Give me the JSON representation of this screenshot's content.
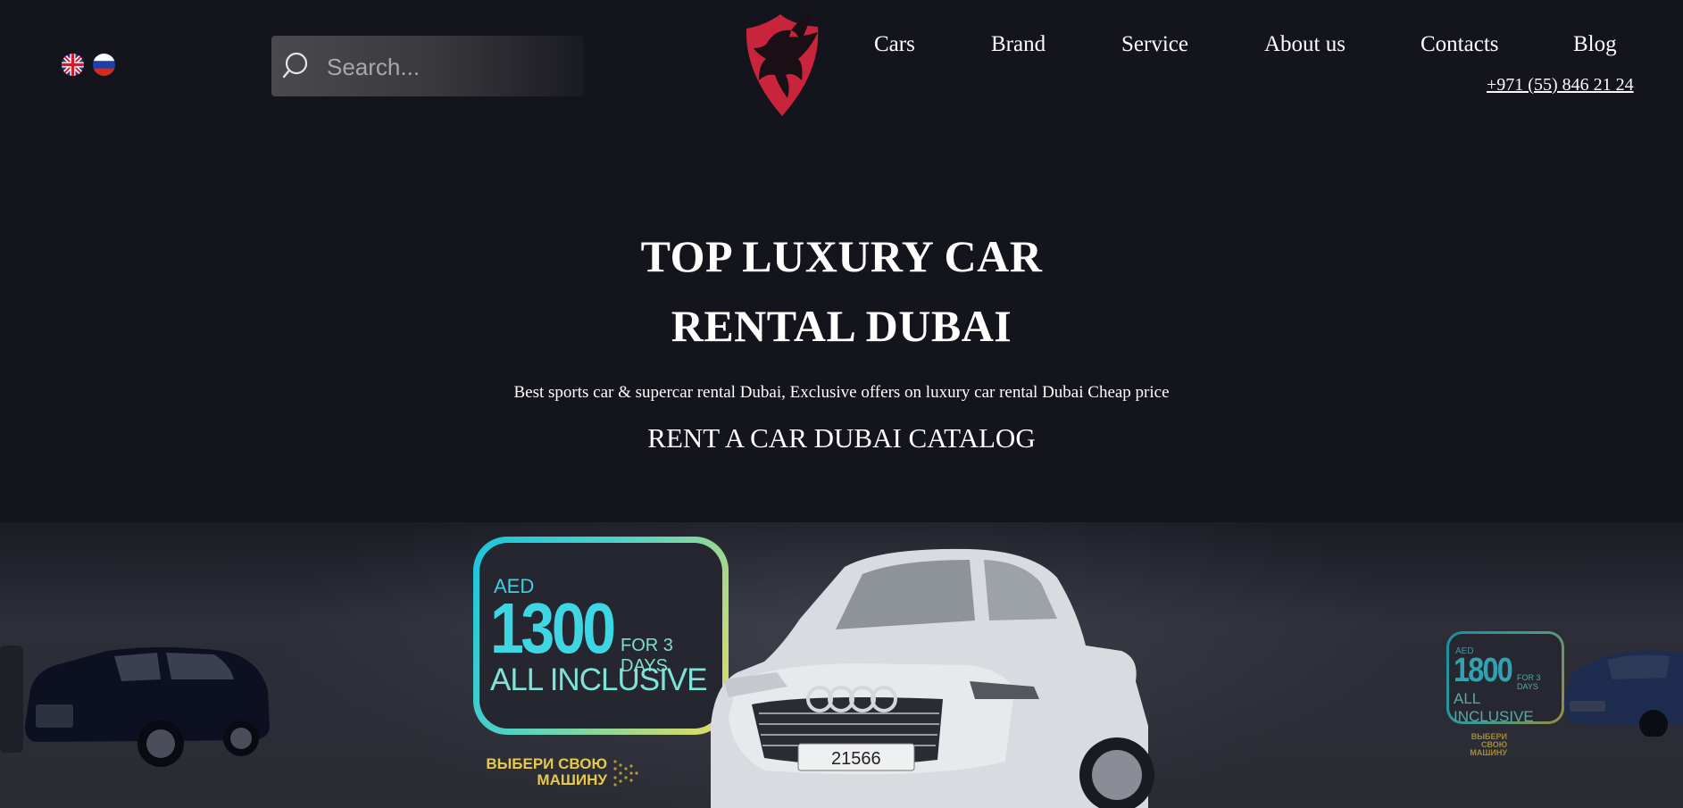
{
  "header": {
    "search_placeholder": "Search...",
    "nav": [
      {
        "label": "Cars"
      },
      {
        "label": "Brand"
      },
      {
        "label": "Service"
      },
      {
        "label": "About us"
      },
      {
        "label": "Contacts"
      },
      {
        "label": "Blog"
      }
    ],
    "phone": "+971 (55) 846 21 24",
    "languages": [
      "english-flag",
      "russian-flag"
    ]
  },
  "hero": {
    "title_line1": "TOP LUXURY CAR",
    "title_line2": "RENTAL DUBAI",
    "subtitle": "Best sports car & supercar rental Dubai, Exclusive offers on luxury car rental Dubai Cheap price",
    "catalog_heading": "RENT A CAR DUBAI CATALOG"
  },
  "slider": {
    "main_promo": {
      "currency": "AED",
      "amount": "1300",
      "period": "FOR 3 DAYS",
      "tagline": "ALL INCLUSIVE",
      "cta_line1": "ВЫБЕРИ СВОЮ",
      "cta_line2": "МАШИНУ",
      "plate": "21566"
    },
    "side_promo": {
      "currency": "AED",
      "amount": "1800",
      "period": "FOR 3 DAYS",
      "tagline": "ALL INCLUSIVE",
      "cta_line1": "ВЫБЕРИ СВОЮ",
      "cta_line2": "МАШИНУ"
    }
  },
  "colors": {
    "background": "#13141c",
    "brand_red": "#c8243b",
    "promo_cyan": "#3fd6e4",
    "promo_yellow": "#e6c84a"
  }
}
